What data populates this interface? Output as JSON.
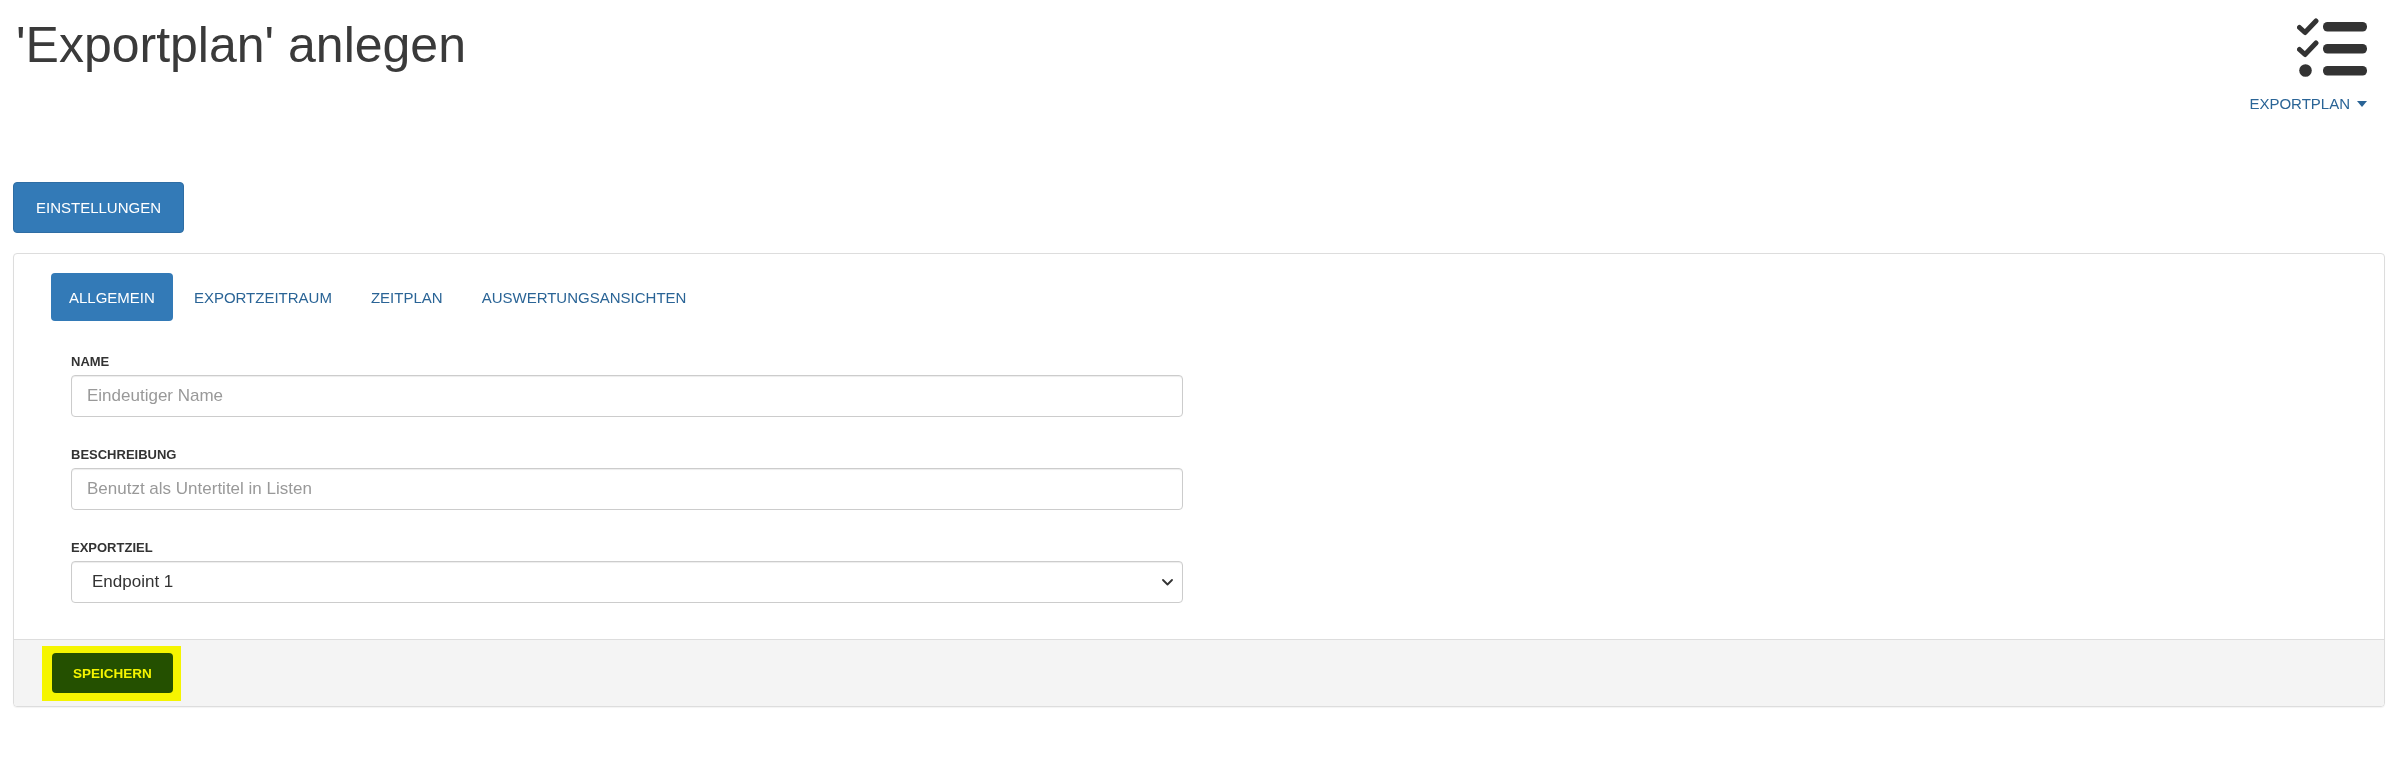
{
  "page": {
    "title": "'Exportplan' anlegen"
  },
  "header_menu": {
    "label": "EXPORTPLAN"
  },
  "settings_button": {
    "label": "EINSTELLUNGEN"
  },
  "tabs": [
    {
      "label": "ALLGEMEIN",
      "selected": true
    },
    {
      "label": "EXPORTZEITRAUM",
      "selected": false
    },
    {
      "label": "ZEITPLAN",
      "selected": false
    },
    {
      "label": "AUSWERTUNGSANSICHTEN",
      "selected": false
    }
  ],
  "form": {
    "fields": [
      {
        "kind": "text",
        "label": "NAME",
        "placeholder": "Eindeutiger Name"
      },
      {
        "kind": "text",
        "label": "BESCHREIBUNG",
        "placeholder": "Benutzt als Untertitel in Listen"
      },
      {
        "kind": "select",
        "label": "EXPORTZIEL",
        "value": "Endpoint 1"
      }
    ]
  },
  "footer": {
    "save_button": {
      "label": "SPEICHERN",
      "highlighted": true
    }
  }
}
